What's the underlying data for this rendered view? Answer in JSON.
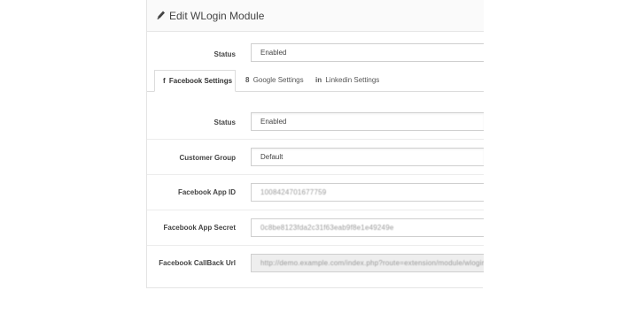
{
  "module": {
    "title": "Edit WLogin Module",
    "status_label": "Status",
    "status_value": "Enabled"
  },
  "tabs": [
    {
      "icon": "f",
      "label": "Facebook Settings",
      "active": true
    },
    {
      "icon": "8",
      "label": "Google Settings",
      "active": false
    },
    {
      "icon": "in",
      "label": "Linkedin Settings",
      "active": false
    }
  ],
  "facebook": {
    "status_label": "Status",
    "status_value": "Enabled",
    "customer_group_label": "Customer Group",
    "customer_group_value": "Default",
    "app_id_label": "Facebook App ID",
    "app_id_value": "1008424701677759",
    "app_secret_label": "Facebook App Secret",
    "app_secret_value": "0c8be8123fda2c31f63eab9f8e1e49249e",
    "callback_label": "Facebook CallBack Url",
    "callback_value": "http://demo.example.com/index.php?route=extension/module/wlogin/facebook"
  }
}
